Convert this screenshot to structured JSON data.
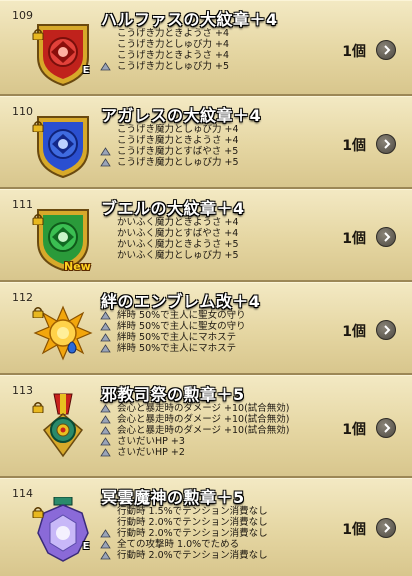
{
  "items": [
    {
      "number": "109",
      "name": "ハルファスの大紋章＋4",
      "count": "1個",
      "new_label": "",
      "stats": [
        {
          "text": "こうげき力ときようさ +4",
          "locked": false
        },
        {
          "text": "こうげき力としゅび力 +4",
          "locked": false
        },
        {
          "text": "こうげき力ときようさ +4",
          "locked": false
        },
        {
          "text": "こうげき力としゅび力 +5",
          "locked": true
        }
      ]
    },
    {
      "number": "110",
      "name": "アガレスの大紋章＋4",
      "count": "1個",
      "new_label": "",
      "stats": [
        {
          "text": "こうげき魔力としゅび力 +4",
          "locked": false
        },
        {
          "text": "こうげき魔力ときようさ +4",
          "locked": false
        },
        {
          "text": "こうげき魔力とすばやさ +5",
          "locked": true
        },
        {
          "text": "こうげき魔力としゅび力 +5",
          "locked": true
        }
      ]
    },
    {
      "number": "111",
      "name": "ブエルの大紋章＋4",
      "count": "1個",
      "new_label": "New",
      "stats": [
        {
          "text": "かいふく魔力ときようさ +4",
          "locked": false
        },
        {
          "text": "かいふく魔力とすばやさ +4",
          "locked": false
        },
        {
          "text": "かいふく魔力ときようさ +5",
          "locked": false
        },
        {
          "text": "かいふく魔力としゅび力 +5",
          "locked": false
        }
      ]
    },
    {
      "number": "112",
      "name": "絆のエンブレム改＋4",
      "count": "1個",
      "new_label": "",
      "stats": [
        {
          "text": "絆時 50%で主人に聖女の守り",
          "locked": true
        },
        {
          "text": "絆時 50%で主人に聖女の守り",
          "locked": true
        },
        {
          "text": "絆時 50%で主人にマホステ",
          "locked": true
        },
        {
          "text": "絆時 50%で主人にマホステ",
          "locked": true
        }
      ]
    },
    {
      "number": "113",
      "name": "邪教司祭の勲章＋5",
      "count": "1個",
      "new_label": "",
      "stats": [
        {
          "text": "会心と暴走時のダメージ +10(試合無効)",
          "locked": true
        },
        {
          "text": "会心と暴走時のダメージ +10(試合無効)",
          "locked": true
        },
        {
          "text": "会心と暴走時のダメージ +10(試合無効)",
          "locked": true
        },
        {
          "text": "さいだいHP +3",
          "locked": true
        },
        {
          "text": "さいだいHP +2",
          "locked": true
        }
      ]
    },
    {
      "number": "114",
      "name": "冥雲魔神の勲章＋5",
      "count": "1個",
      "new_label": "",
      "stats": [
        {
          "text": "行動時 1.5%でテンション消費なし",
          "locked": false
        },
        {
          "text": "行動時 2.0%でテンション消費なし",
          "locked": false
        },
        {
          "text": "行動時 2.0%でテンション消費なし",
          "locked": true
        },
        {
          "text": "全ての攻撃時 1.0%でためる",
          "locked": true
        },
        {
          "text": "行動時 2.0%でテンション消費なし",
          "locked": true
        }
      ]
    }
  ],
  "badges": {
    "equip_letter": "E"
  },
  "colors": {
    "halphas": "#c0221c",
    "agares": "#2a4fd0",
    "buer": "#2a9a3a",
    "bond": "#f2a60c",
    "cultist": "#2a8a6a",
    "demon": "#8a6ad8"
  }
}
